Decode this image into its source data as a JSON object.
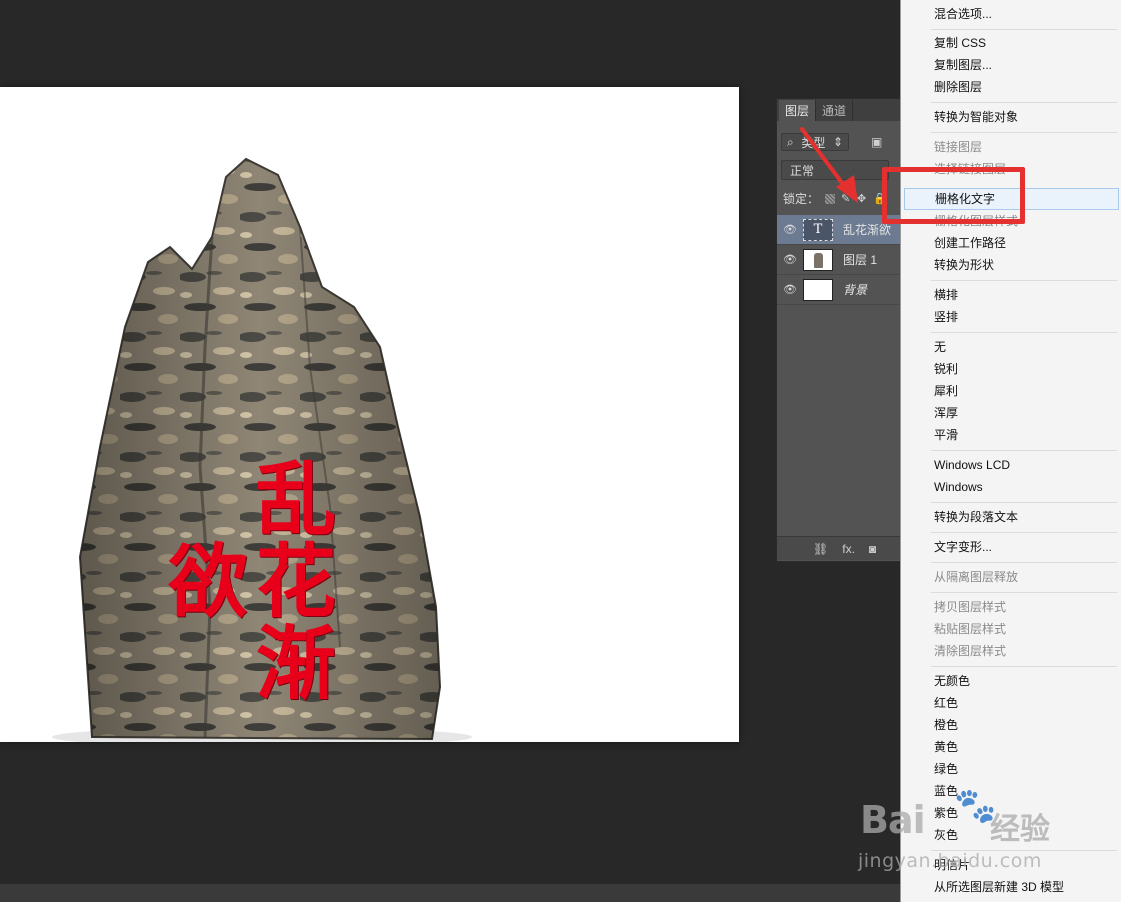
{
  "canvas": {
    "text": "乱花渐欲",
    "text_color": "#e8001a"
  },
  "layers_panel": {
    "tabs": [
      {
        "label": "图层",
        "active": true
      },
      {
        "label": "通道",
        "active": false
      }
    ],
    "filter": {
      "label": "类型",
      "icon": "search-icon"
    },
    "blend_mode": "正常",
    "lock_label": "锁定：",
    "layers": [
      {
        "name": "乱花渐欲",
        "type": "text",
        "selected": true,
        "visible": true
      },
      {
        "name": "图层 1",
        "type": "image",
        "selected": false,
        "visible": true
      },
      {
        "name": "背景",
        "type": "background",
        "selected": false,
        "visible": true
      }
    ],
    "footer_icons": [
      "link-icon",
      "fx-icon",
      "mask-icon"
    ],
    "footer_fx_label": "fx."
  },
  "context_menu": {
    "items": [
      {
        "label": "混合选项...",
        "disabled": false
      },
      {
        "label": "复制 CSS",
        "disabled": false
      },
      {
        "label": "复制图层...",
        "disabled": false
      },
      {
        "label": "删除图层",
        "disabled": false
      },
      {
        "label": "转换为智能对象",
        "disabled": false
      },
      {
        "label": "链接图层",
        "disabled": true
      },
      {
        "label": "选择链接图层",
        "disabled": true
      },
      {
        "label": "栅格化文字",
        "disabled": false,
        "hover": true
      },
      {
        "label": "栅格化图层样式",
        "disabled": true
      },
      {
        "label": "创建工作路径",
        "disabled": false
      },
      {
        "label": "转换为形状",
        "disabled": false
      },
      {
        "label": "横排",
        "disabled": false
      },
      {
        "label": "竖排",
        "disabled": false
      },
      {
        "label": "无",
        "disabled": false
      },
      {
        "label": "锐利",
        "disabled": false
      },
      {
        "label": "犀利",
        "disabled": false
      },
      {
        "label": "浑厚",
        "disabled": false
      },
      {
        "label": "平滑",
        "disabled": false
      },
      {
        "label": "Windows LCD",
        "disabled": false
      },
      {
        "label": "Windows",
        "disabled": false
      },
      {
        "label": "转换为段落文本",
        "disabled": false
      },
      {
        "label": "文字变形...",
        "disabled": false
      },
      {
        "label": "从隔离图层释放",
        "disabled": true
      },
      {
        "label": "拷贝图层样式",
        "disabled": true
      },
      {
        "label": "粘贴图层样式",
        "disabled": true
      },
      {
        "label": "清除图层样式",
        "disabled": true
      },
      {
        "label": "无颜色",
        "disabled": false
      },
      {
        "label": "红色",
        "disabled": false
      },
      {
        "label": "橙色",
        "disabled": false
      },
      {
        "label": "黄色",
        "disabled": false
      },
      {
        "label": "绿色",
        "disabled": false
      },
      {
        "label": "蓝色",
        "disabled": false
      },
      {
        "label": "紫色",
        "disabled": false
      },
      {
        "label": "灰色",
        "disabled": false
      },
      {
        "label": "明信片",
        "disabled": false
      },
      {
        "label": "从所选图层新建 3D 模型",
        "disabled": false
      }
    ]
  },
  "annotation": {
    "highlight_color": "#e4312f"
  },
  "watermark": {
    "brand": "Bai",
    "paw": "🐾",
    "jingyan": "经验",
    "url": "jingyan.baidu.com"
  }
}
